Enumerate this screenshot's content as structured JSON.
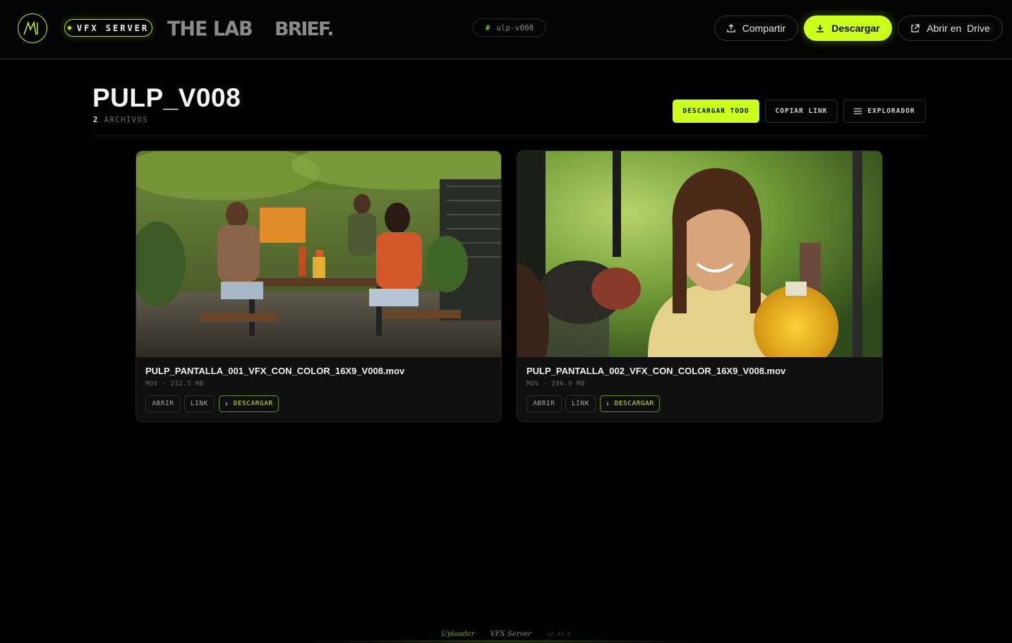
{
  "header": {
    "logo_text": "ʌM",
    "vfx_badge": "VFX SERVER",
    "brand_lab": "THE LAB",
    "brand_brief": "BRIEF.",
    "tag_hash": "#",
    "tag_value": "ulp-v008",
    "share_label": "Compartir",
    "download_label": "Descargar",
    "drive_label": "Abrir en  Drive",
    "icons": {
      "share": "upload-icon",
      "download": "download-icon",
      "drive": "external-link-icon"
    }
  },
  "folder": {
    "title": "PULP_V008",
    "count": "2",
    "count_label": "ARCHIVOS",
    "actions": {
      "download_all": "DESCARGAR TODO",
      "copy_link": "COPIAR LINK",
      "explorer": "EXPLORADOR"
    }
  },
  "files": [
    {
      "name": "PULP_PANTALLA_001_VFX_CON_COLOR_16X9_V008.mov",
      "meta": "MOV · 232.5 MB",
      "open": "ABRIR",
      "link": "LINK",
      "download": "↓ DESCARGAR",
      "thumbnail": "video-thumbnail-group-dining-table"
    },
    {
      "name": "PULP_PANTALLA_002_VFX_CON_COLOR_16X9_V008.mov",
      "meta": "MOV · 296.9 MB",
      "open": "ABRIR",
      "link": "LINK",
      "download": "↓ DESCARGAR",
      "thumbnail": "video-thumbnail-woman-smiling"
    }
  ],
  "footer": {
    "uploader": "Uploader",
    "server": "VFX Server",
    "version": "v2.45.0"
  },
  "colors": {
    "accent": "#cbff1c",
    "background": "#000000",
    "card": "#0f0f10"
  }
}
